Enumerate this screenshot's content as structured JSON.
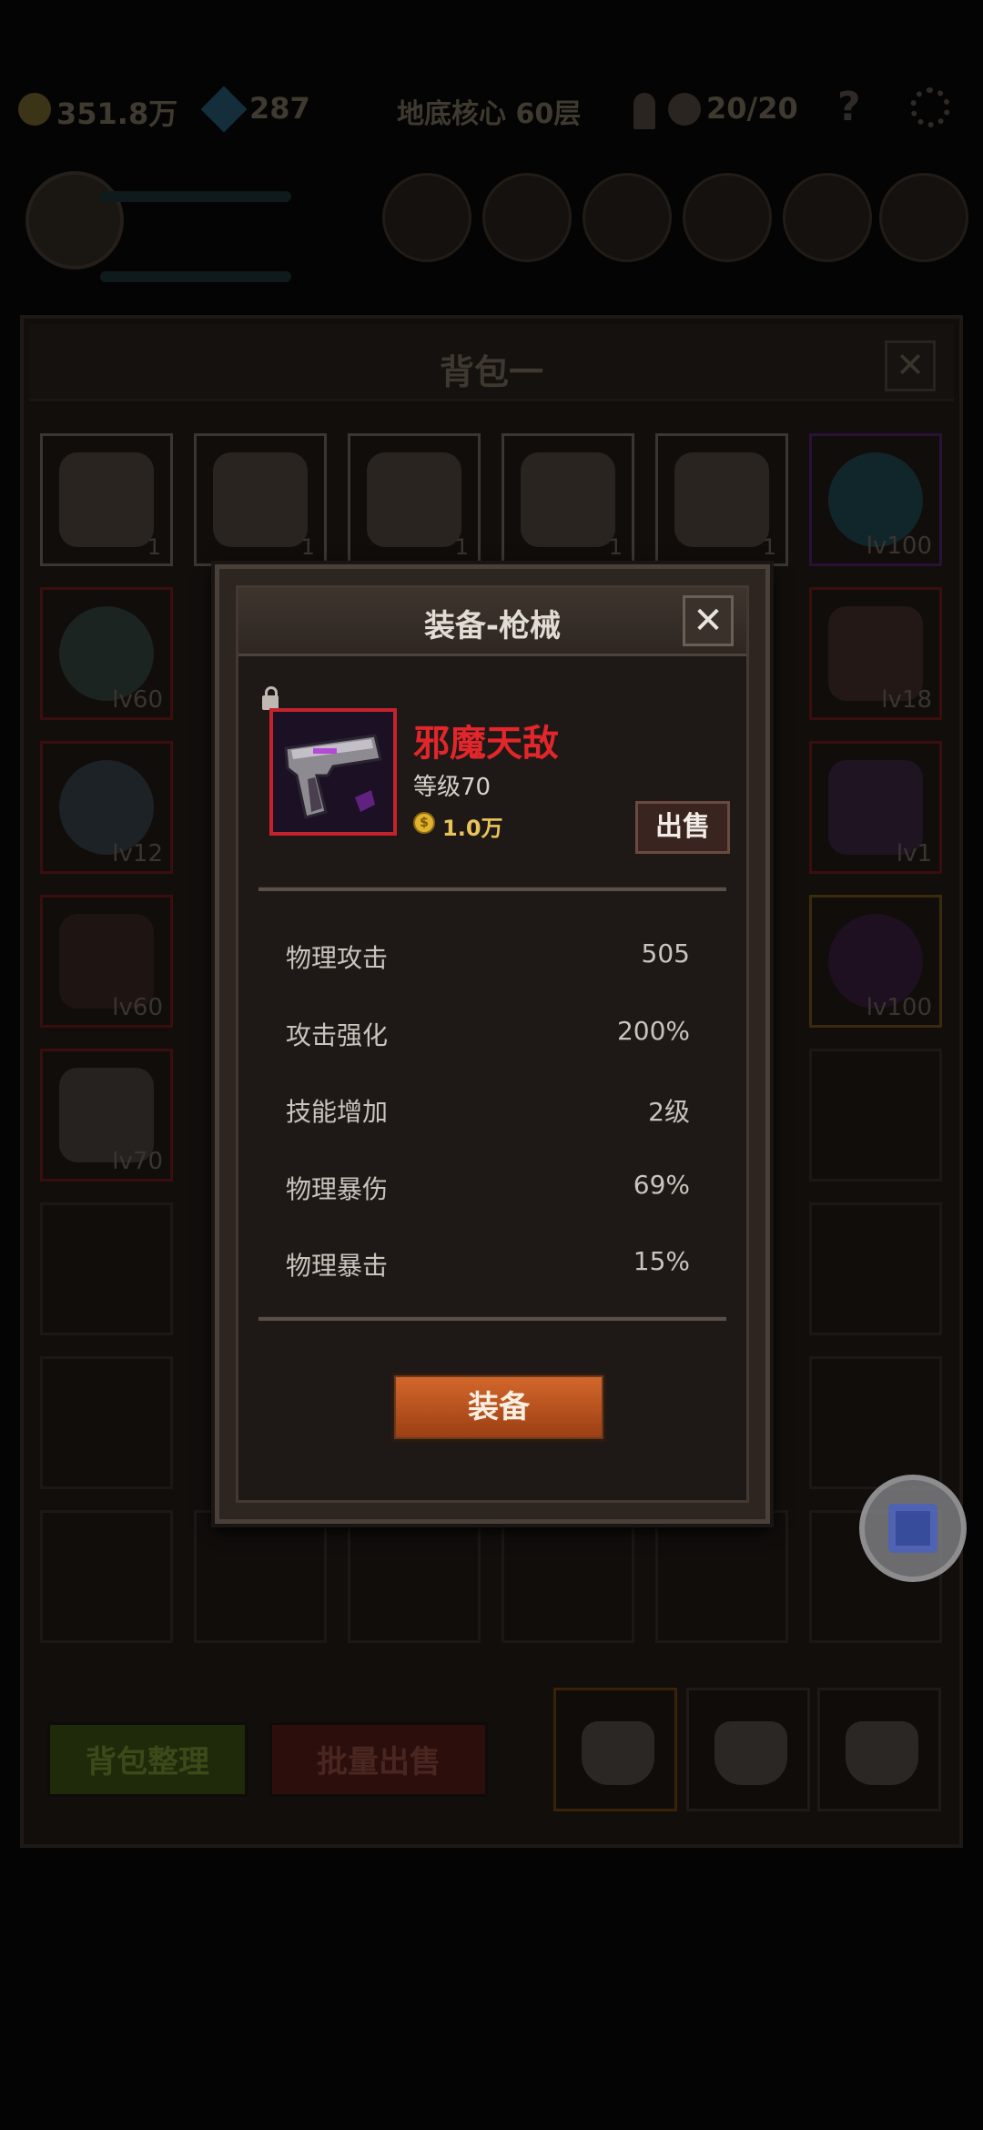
{
  "hud": {
    "gold": "351.8万",
    "gems": "287",
    "location": "地底核心 60层",
    "keys": "20/20",
    "help": "?"
  },
  "panel": {
    "title": "背包一",
    "close": "✕",
    "slots": [
      {
        "count": "1"
      },
      {
        "count": "1"
      },
      {
        "count": "1"
      },
      {
        "count": "1"
      },
      {
        "count": "1"
      },
      {
        "level": "lv100"
      },
      {
        "level": "lv60"
      },
      {
        "level": "lv18"
      },
      {
        "level": "lv12"
      },
      {
        "level": "lv1"
      },
      {
        "level": "lv60"
      },
      {
        "level": "lv100"
      },
      {
        "level": "lv70"
      }
    ],
    "sort_button": "背包整理",
    "bulk_sell_button": "批量出售"
  },
  "dialog": {
    "title": "装备-枪械",
    "close": "✕",
    "item": {
      "name": "邪魔天敌",
      "level": "等级70",
      "coin_symbol": "$",
      "price": "1.0万",
      "sell_button": "出售"
    },
    "stats": [
      {
        "label": "物理攻击",
        "value": "505"
      },
      {
        "label": "攻击强化",
        "value": "200%"
      },
      {
        "label": "技能增加",
        "value": "2级"
      },
      {
        "label": "物理暴伤",
        "value": "69%"
      },
      {
        "label": "物理暴击",
        "value": "15%"
      }
    ],
    "equip_button": "装备"
  },
  "colors": {
    "name_red": "#e2262b",
    "equip_orange": "#c85a22",
    "price_gold": "#e9c35a"
  }
}
